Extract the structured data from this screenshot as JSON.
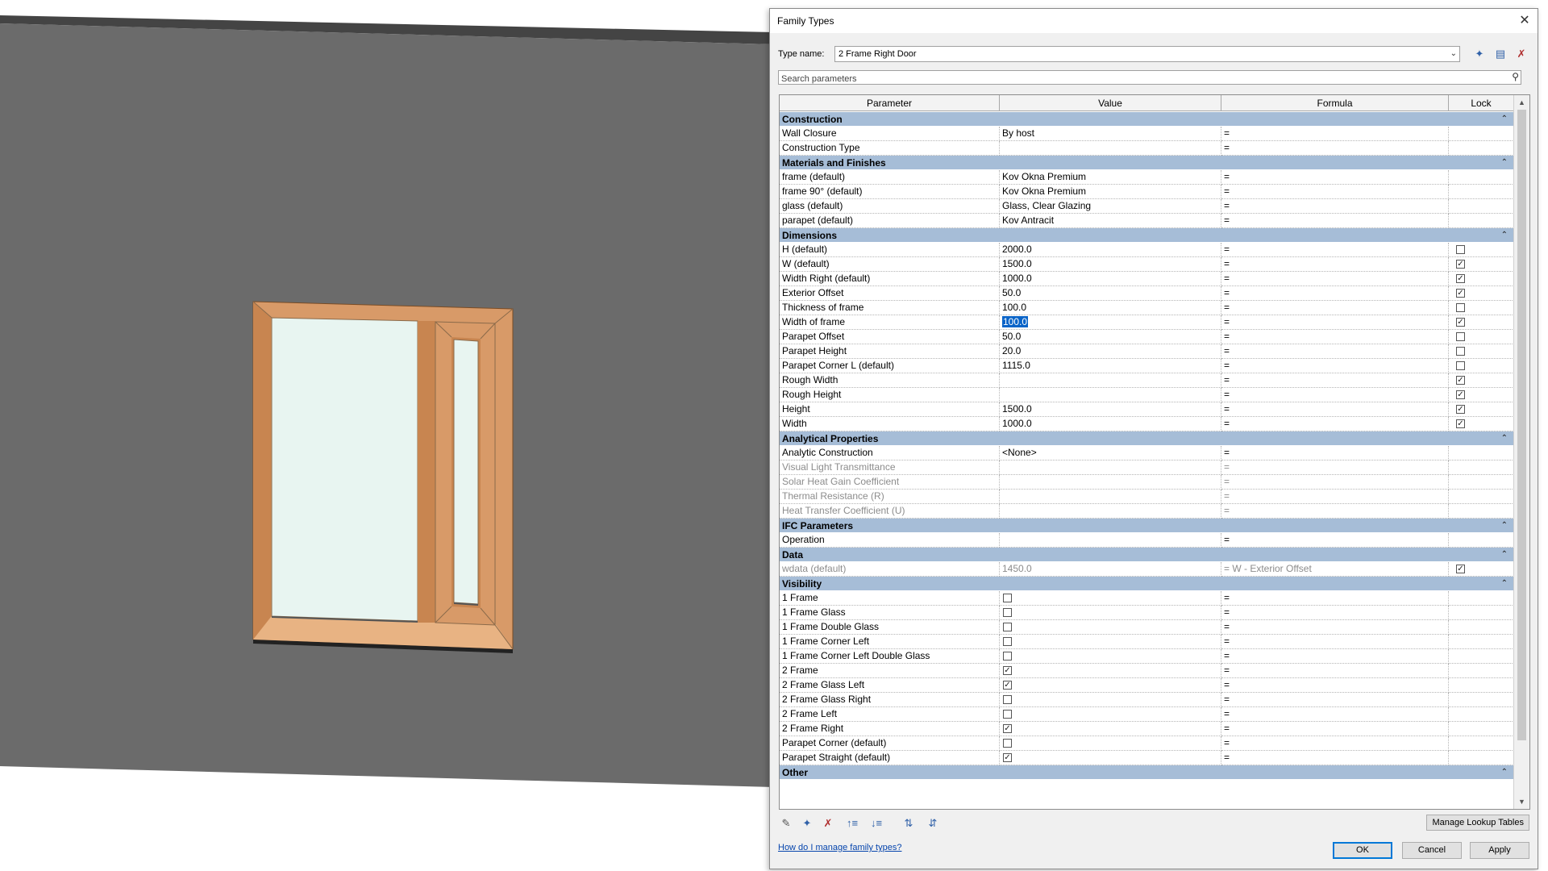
{
  "dialog": {
    "title": "Family Types",
    "close_glyph": "✕",
    "type_name_label": "Type name:",
    "type_name_value": "2 Frame Right Door",
    "search_placeholder": "Search parameters",
    "columns": [
      "Parameter",
      "Value",
      "Formula",
      "Lock"
    ],
    "manage_lookup_label": "Manage Lookup Tables",
    "help_link": "How do I manage family types?",
    "ok_label": "OK",
    "cancel_label": "Cancel",
    "apply_label": "Apply"
  },
  "groups": [
    {
      "name": "Construction",
      "rows": [
        {
          "param": "Wall Closure",
          "value": "By host",
          "formula": "="
        },
        {
          "param": "Construction Type",
          "value": "",
          "formula": "="
        }
      ]
    },
    {
      "name": "Materials and Finishes",
      "rows": [
        {
          "param": "frame (default)",
          "value": "Kov Okna Premium",
          "formula": "="
        },
        {
          "param": "frame 90° (default)",
          "value": "Kov Okna Premium",
          "formula": "="
        },
        {
          "param": "glass (default)",
          "value": "Glass, Clear Glazing",
          "formula": "="
        },
        {
          "param": "parapet (default)",
          "value": "Kov Antracit",
          "formula": "="
        }
      ]
    },
    {
      "name": "Dimensions",
      "rows": [
        {
          "param": "H (default)",
          "value": "2000.0",
          "formula": "=",
          "lock": false
        },
        {
          "param": "W (default)",
          "value": "1500.0",
          "formula": "=",
          "lock": true
        },
        {
          "param": "Width Right (default)",
          "value": "1000.0",
          "formula": "=",
          "lock": true
        },
        {
          "param": "Exterior Offset",
          "value": "50.0",
          "formula": "=",
          "lock": true
        },
        {
          "param": "Thickness of frame",
          "value": "100.0",
          "formula": "=",
          "lock": false
        },
        {
          "param": "Width of frame",
          "value": "100.0",
          "formula": "=",
          "lock": true,
          "selected": true
        },
        {
          "param": "Parapet Offset",
          "value": "50.0",
          "formula": "=",
          "lock": false
        },
        {
          "param": "Parapet Height",
          "value": "20.0",
          "formula": "=",
          "lock": false
        },
        {
          "param": "Parapet Corner L (default)",
          "value": "1115.0",
          "formula": "=",
          "lock": false
        },
        {
          "param": "Rough Width",
          "value": "",
          "formula": "=",
          "lock": true
        },
        {
          "param": "Rough Height",
          "value": "",
          "formula": "=",
          "lock": true
        },
        {
          "param": "Height",
          "value": "1500.0",
          "formula": "=",
          "lock": true
        },
        {
          "param": "Width",
          "value": "1000.0",
          "formula": "=",
          "lock": true
        }
      ]
    },
    {
      "name": "Analytical Properties",
      "rows": [
        {
          "param": "Analytic Construction",
          "value": "<None>",
          "formula": "="
        },
        {
          "param": "Visual Light Transmittance",
          "value": "",
          "formula": "=",
          "grey": true
        },
        {
          "param": "Solar Heat Gain Coefficient",
          "value": "",
          "formula": "=",
          "grey": true
        },
        {
          "param": "Thermal Resistance (R)",
          "value": "",
          "formula": "=",
          "grey": true
        },
        {
          "param": "Heat Transfer Coefficient (U)",
          "value": "",
          "formula": "=",
          "grey": true
        }
      ]
    },
    {
      "name": "IFC Parameters",
      "rows": [
        {
          "param": "Operation",
          "value": "",
          "formula": "="
        }
      ]
    },
    {
      "name": "Data",
      "rows": [
        {
          "param": "wdata (default)",
          "value": "1450.0",
          "formula": "= W - Exterior Offset",
          "lock": true,
          "grey": true
        }
      ]
    },
    {
      "name": "Visibility",
      "rows": [
        {
          "param": "1 Frame",
          "check": false,
          "formula": "="
        },
        {
          "param": "1 Frame Glass",
          "check": false,
          "formula": "="
        },
        {
          "param": "1 Frame Double Glass",
          "check": false,
          "formula": "="
        },
        {
          "param": "1 Frame Corner Left",
          "check": false,
          "formula": "="
        },
        {
          "param": "1 Frame Corner Left Double Glass",
          "check": false,
          "formula": "="
        },
        {
          "param": "2 Frame",
          "check": true,
          "formula": "="
        },
        {
          "param": "2 Frame Glass Left",
          "check": true,
          "formula": "="
        },
        {
          "param": "2 Frame Glass Right",
          "check": false,
          "formula": "="
        },
        {
          "param": "2 Frame Left",
          "check": false,
          "formula": "="
        },
        {
          "param": "2 Frame Right",
          "check": true,
          "formula": "="
        },
        {
          "param": "Parapet Corner (default)",
          "check": false,
          "formula": "="
        },
        {
          "param": "Parapet Straight (default)",
          "check": true,
          "formula": "="
        }
      ]
    },
    {
      "name": "Other",
      "rows": []
    }
  ],
  "icons": {
    "collapse": "chevron-up-double-icon",
    "toolbar_top": [
      "new-type-icon",
      "rename-type-icon",
      "delete-type-icon"
    ],
    "toolbar_bottom": [
      "edit-pencil-icon",
      "new-parameter-icon",
      "delete-parameter-icon",
      "move-up-icon",
      "move-down-icon",
      "sort-ascending-icon",
      "sort-descending-icon"
    ]
  },
  "colors": {
    "group_header": "#a6bdd7",
    "selection": "#0a64c8",
    "wall": "#6b6b6b",
    "frame": "#d89a68",
    "glass": "#e8f5f1"
  }
}
